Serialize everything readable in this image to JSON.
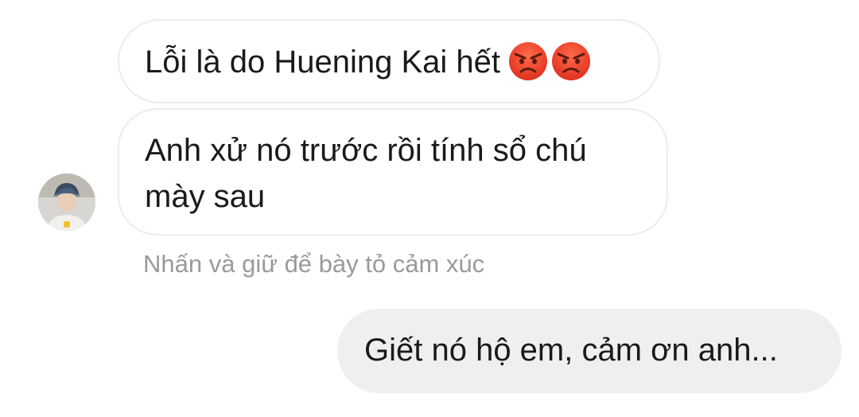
{
  "messages": {
    "received": [
      {
        "text": "Lỗi là do Huening Kai hết",
        "emoji": [
          "angry-face",
          "angry-face"
        ]
      },
      {
        "text": "Anh xử nó trước rồi tính sổ chú mày sau"
      }
    ],
    "sent": [
      {
        "text": "Giết nó hộ em, cảm ơn anh..."
      }
    ]
  },
  "reaction_hint": "Nhấn và giữ để bày tỏ cảm xúc",
  "colors": {
    "sent_bubble": "#efefef",
    "received_border": "#ececec",
    "hint_text": "#9a9a9a",
    "emoji_red": "#e8433a"
  }
}
